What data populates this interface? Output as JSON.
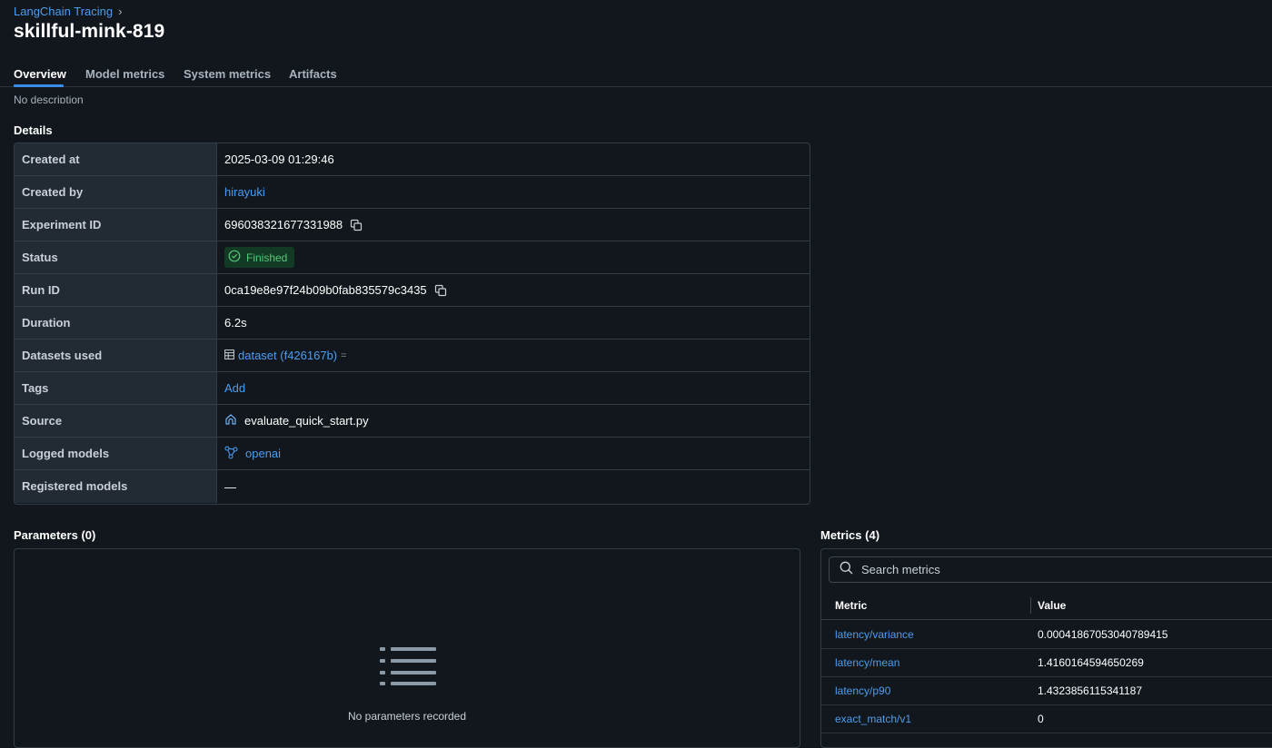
{
  "breadcrumb": {
    "parent": "LangChain Tracing",
    "separator": "›"
  },
  "run_name": "skillful-mink-819",
  "tabs": [
    {
      "label": "Overview",
      "active": true
    },
    {
      "label": "Model metrics",
      "active": false
    },
    {
      "label": "System metrics",
      "active": false
    },
    {
      "label": "Artifacts",
      "active": false
    }
  ],
  "description": "No description",
  "details": {
    "title": "Details",
    "created_at": {
      "label": "Created at",
      "value": "2025-03-09 01:29:46"
    },
    "created_by": {
      "label": "Created by",
      "value": "hirayuki"
    },
    "experiment_id": {
      "label": "Experiment ID",
      "value": "696038321677331988"
    },
    "status": {
      "label": "Status",
      "value": "Finished"
    },
    "run_id": {
      "label": "Run ID",
      "value": "0ca19e8e97f24b09b0fab835579c3435"
    },
    "duration": {
      "label": "Duration",
      "value": "6.2s"
    },
    "datasets": {
      "label": "Datasets used",
      "value": "dataset (f426167b)",
      "suffix": "="
    },
    "tags": {
      "label": "Tags",
      "value": "Add"
    },
    "source": {
      "label": "Source",
      "value": "evaluate_quick_start.py"
    },
    "logged_models": {
      "label": "Logged models",
      "value": "openai"
    },
    "registered_models": {
      "label": "Registered models",
      "value": "—"
    }
  },
  "parameters": {
    "title": "Parameters (0)",
    "empty_text": "No parameters recorded"
  },
  "metrics": {
    "title": "Metrics (4)",
    "search_placeholder": "Search metrics",
    "columns": {
      "metric": "Metric",
      "value": "Value"
    },
    "rows": [
      {
        "name": "latency/variance",
        "value": "0.00041867053040789415"
      },
      {
        "name": "latency/mean",
        "value": "1.4160164594650269"
      },
      {
        "name": "latency/p90",
        "value": "1.4323856115341187"
      },
      {
        "name": "exact_match/v1",
        "value": "0"
      }
    ]
  },
  "colors": {
    "background": "#11171d",
    "link": "#4c9df0",
    "accent": "#3b8ce8",
    "status_bg": "#123a24",
    "status_fg": "#57c779"
  }
}
